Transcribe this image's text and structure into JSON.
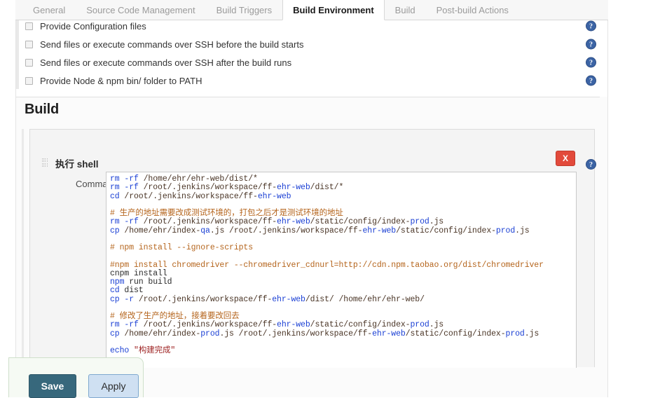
{
  "tabs": [
    {
      "label": "General",
      "active": false
    },
    {
      "label": "Source Code Management",
      "active": false
    },
    {
      "label": "Build Triggers",
      "active": false
    },
    {
      "label": "Build Environment",
      "active": true
    },
    {
      "label": "Build",
      "active": false
    },
    {
      "label": "Post-build Actions",
      "active": false
    }
  ],
  "build_environment": {
    "options": [
      {
        "label": "Provide Configuration files",
        "checked": false,
        "help": "help-icon"
      },
      {
        "label": "Send files or execute commands over SSH before the build starts",
        "checked": false,
        "help": "help-icon"
      },
      {
        "label": "Send files or execute commands over SSH after the build runs",
        "checked": false,
        "help": "help-icon"
      },
      {
        "label": "Provide Node & npm bin/ folder to PATH",
        "checked": false,
        "help": "help-icon"
      }
    ]
  },
  "build_section": {
    "heading": "Build",
    "builder": {
      "title": "执行 shell",
      "delete_label": "X",
      "command_label": "Command",
      "command_value": "rm -rf /home/ehr/ehr-web/dist/*\nrm -rf /root/.jenkins/workspace/ff-ehr-web/dist/*\ncd /root/.jenkins/workspace/ff-ehr-web\n\n# 生产的地址需要改成测试环境的，打包之后才是测试环境的地址\nrm -rf /root/.jenkins/workspace/ff-ehr-web/static/config/index-prod.js\ncp /home/ehr/index-qa.js /root/.jenkins/workspace/ff-ehr-web/static/config/index-prod.js\n\n# npm install --ignore-scripts\n\n#npm install chromedriver --chromedriver_cdnurl=http://cdn.npm.taobao.org/dist/chromedriver\ncnpm install\nnpm run build\ncd dist\ncp -r /root/.jenkins/workspace/ff-ehr-web/dist/ /home/ehr/ehr-web/\n\n# 修改了生产的地址，接着要改回去\nrm -rf /root/.jenkins/workspace/ff-ehr-web/static/config/index-prod.js\ncp /home/ehr/index-prod.js /root/.jenkins/workspace/ff-ehr-web/static/config/index-prod.js\n\necho \"构建完成\"",
      "command_lines": [
        {
          "tokens": [
            {
              "t": "rm -rf ",
              "c": "cmd"
            },
            {
              "t": "/home/ehr/ehr-web/dist/*",
              "c": "path"
            }
          ]
        },
        {
          "tokens": [
            {
              "t": "rm -rf ",
              "c": "cmd"
            },
            {
              "t": "/root/.jenkins/workspace/ff-",
              "c": "path"
            },
            {
              "t": "ehr-web",
              "c": "cmd"
            },
            {
              "t": "/dist/*",
              "c": "path"
            }
          ]
        },
        {
          "tokens": [
            {
              "t": "cd ",
              "c": "cmd"
            },
            {
              "t": "/root/.jenkins/workspace/ff-",
              "c": "path"
            },
            {
              "t": "ehr-web",
              "c": "cmd"
            }
          ]
        },
        {
          "tokens": []
        },
        {
          "tokens": [
            {
              "t": "# 生产的地址需要改成测试环境的，打包之后才是测试环境的地址",
              "c": "note"
            }
          ]
        },
        {
          "tokens": [
            {
              "t": "rm -rf ",
              "c": "cmd"
            },
            {
              "t": "/root/.jenkins/workspace/ff-",
              "c": "path"
            },
            {
              "t": "ehr-web",
              "c": "cmd"
            },
            {
              "t": "/static/config/index-",
              "c": "path"
            },
            {
              "t": "prod",
              "c": "cmd"
            },
            {
              "t": ".js",
              "c": "path"
            }
          ]
        },
        {
          "tokens": [
            {
              "t": "cp ",
              "c": "cmd"
            },
            {
              "t": "/home/ehr/index-",
              "c": "path"
            },
            {
              "t": "qa",
              "c": "cmd"
            },
            {
              "t": ".js /root/.jenkins/workspace/ff-",
              "c": "path"
            },
            {
              "t": "ehr-web",
              "c": "cmd"
            },
            {
              "t": "/static/config/index-",
              "c": "path"
            },
            {
              "t": "prod",
              "c": "cmd"
            },
            {
              "t": ".js",
              "c": "path"
            }
          ]
        },
        {
          "tokens": []
        },
        {
          "tokens": [
            {
              "t": "# npm install --ignore-scripts",
              "c": "note"
            }
          ]
        },
        {
          "tokens": []
        },
        {
          "tokens": [
            {
              "t": "#npm install chromedriver --chromedriver_cdnurl=http://cdn.npm.taobao.org/dist/chromedriver",
              "c": "note"
            }
          ]
        },
        {
          "tokens": [
            {
              "t": "cnpm",
              "c": "plain"
            },
            {
              "t": " install",
              "c": "plain"
            }
          ]
        },
        {
          "tokens": [
            {
              "t": "npm",
              "c": "cmd"
            },
            {
              "t": " run build",
              "c": "plain"
            }
          ]
        },
        {
          "tokens": [
            {
              "t": "cd ",
              "c": "cmd"
            },
            {
              "t": "dist",
              "c": "plain"
            }
          ]
        },
        {
          "tokens": [
            {
              "t": "cp -r ",
              "c": "cmd"
            },
            {
              "t": "/root/.jenkins/workspace/ff-",
              "c": "path"
            },
            {
              "t": "ehr-web",
              "c": "cmd"
            },
            {
              "t": "/dist/ /home/ehr/ehr-web/",
              "c": "path"
            }
          ]
        },
        {
          "tokens": []
        },
        {
          "tokens": [
            {
              "t": "# 修改了生产的地址，接着要改回去",
              "c": "note"
            }
          ]
        },
        {
          "tokens": [
            {
              "t": "rm -rf ",
              "c": "cmd"
            },
            {
              "t": "/root/.jenkins/workspace/ff-",
              "c": "path"
            },
            {
              "t": "ehr-web",
              "c": "cmd"
            },
            {
              "t": "/static/config/index-",
              "c": "path"
            },
            {
              "t": "prod",
              "c": "cmd"
            },
            {
              "t": ".js",
              "c": "path"
            }
          ]
        },
        {
          "tokens": [
            {
              "t": "cp ",
              "c": "cmd"
            },
            {
              "t": "/home/ehr/index-",
              "c": "path"
            },
            {
              "t": "prod",
              "c": "cmd"
            },
            {
              "t": ".js /root/.jenkins/workspace/ff-",
              "c": "path"
            },
            {
              "t": "ehr-web",
              "c": "cmd"
            },
            {
              "t": "/static/config/index-",
              "c": "path"
            },
            {
              "t": "prod",
              "c": "cmd"
            },
            {
              "t": ".js",
              "c": "path"
            }
          ]
        },
        {
          "tokens": []
        },
        {
          "tokens": [
            {
              "t": "echo ",
              "c": "cmd"
            },
            {
              "t": "\"构建完成\"",
              "c": "str"
            }
          ]
        }
      ]
    }
  },
  "save_bar": {
    "save_label": "Save",
    "apply_label": "Apply"
  },
  "colors": {
    "accent_save": "#37687c",
    "accent_apply": "#cfe0f2",
    "delete_red": "#e24a3b",
    "help_blue": "#3c64a5",
    "comment_orange": "#b5651d",
    "command_blue": "#1a3fd4",
    "string_red": "#9c1f1f"
  }
}
